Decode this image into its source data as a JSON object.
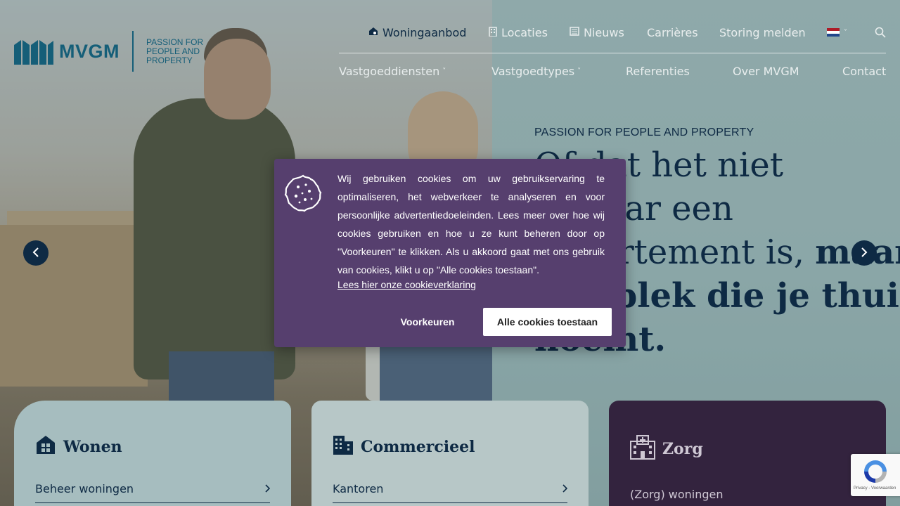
{
  "brand": {
    "name": "MVGM",
    "tagline": "PASSION FOR PEOPLE AND PROPERTY",
    "color": "#155e78"
  },
  "topnav": {
    "items": [
      {
        "label": "Woningaanbod",
        "icon": "house-search-icon"
      },
      {
        "label": "Locaties",
        "icon": "building-icon"
      },
      {
        "label": "Nieuws",
        "icon": "newspaper-icon"
      },
      {
        "label": "Carrières"
      },
      {
        "label": "Storing melden"
      }
    ],
    "language_flag": "nl-flag-icon",
    "search_icon": "search-icon"
  },
  "mainnav": {
    "items": [
      {
        "label": "Vastgoeddiensten",
        "dropdown": true
      },
      {
        "label": "Vastgoedtypes",
        "dropdown": true
      },
      {
        "label": "Referenties"
      },
      {
        "label": "Over MVGM"
      },
      {
        "label": "Contact"
      }
    ]
  },
  "hero": {
    "eyebrow": "PASSION FOR PEOPLE AND PROPERTY",
    "headline_line1": "Of dat het niet",
    "headline_line2": "zomaar een",
    "headline_line3_regular": "appartement is, ",
    "headline_line3_bold": "maar",
    "headline_line4_bold": "een plek die je thuis",
    "headline_line5_bold": "noemt.",
    "prev_icon": "chevron-left-icon",
    "next_icon": "chevron-right-icon"
  },
  "cards": [
    {
      "title": "Wonen",
      "icon": "house-icon",
      "link": "Beheer woningen"
    },
    {
      "title": "Commercieel",
      "icon": "office-buildings-icon",
      "link": "Kantoren"
    },
    {
      "title": "Zorg",
      "icon": "hospital-icon",
      "link": "(Zorg) woningen"
    }
  ],
  "cookie_banner": {
    "text": "Wij gebruiken cookies om uw gebruikservaring te optimaliseren, het webverkeer te analyseren en voor persoonlijke advertentiedoeleinden. Lees meer over hoe wij cookies gebruiken en hoe u ze kunt beheren door op \"Voorkeuren\" te klikken. Als u akkoord gaat met ons gebruik van cookies, klikt u op \"Alle cookies toestaan\".",
    "link": "Lees hier onze cookieverklaring",
    "preferences_button": "Voorkeuren",
    "accept_button": "Alle cookies toestaan",
    "background": "#563f6e",
    "icon": "cookie-icon"
  },
  "recaptcha": {
    "text": "Privacy - Voorwaarden"
  },
  "colors": {
    "navy": "#0e2a44",
    "nav_text": "#e9eeee"
  }
}
